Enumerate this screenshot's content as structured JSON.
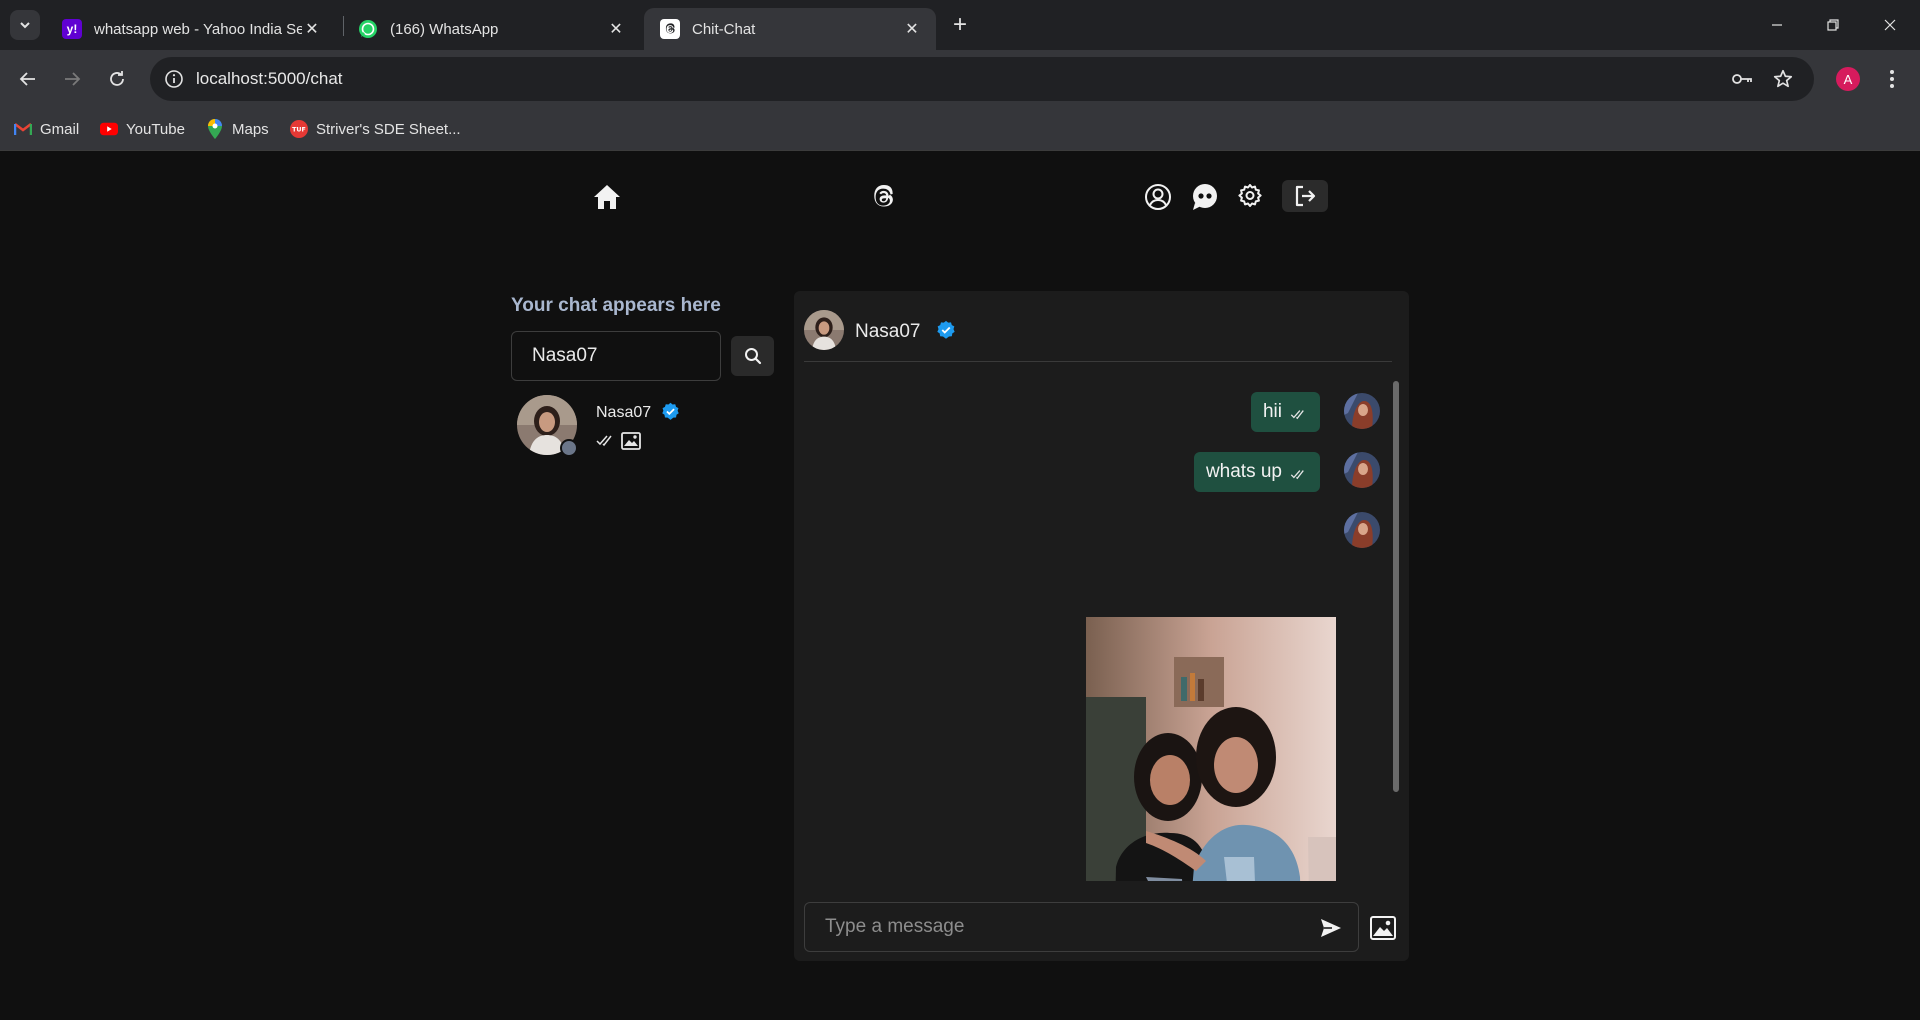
{
  "browser": {
    "tabs": [
      {
        "title": "whatsapp web - Yahoo India Se",
        "favicon": "yahoo-icon",
        "favicon_color": "#6001d2",
        "favicon_text": "y!"
      },
      {
        "title": "(166) WhatsApp",
        "favicon": "whatsapp-icon",
        "favicon_color": "#25d366"
      },
      {
        "title": "Chit-Chat",
        "favicon": "threads-icon",
        "active": true
      }
    ],
    "url": "localhost:5000/chat",
    "profile_initial": "A",
    "profile_color": "#d61b5d",
    "bookmarks": [
      {
        "label": "Gmail",
        "icon": "gmail-icon"
      },
      {
        "label": "YouTube",
        "icon": "youtube-icon"
      },
      {
        "label": "Maps",
        "icon": "maps-icon"
      },
      {
        "label": "Striver's SDE Sheet...",
        "icon": "tuf-icon"
      }
    ]
  },
  "app": {
    "nav_icons": [
      "home-icon",
      "threads-logo-icon",
      "user-profile-icon",
      "chat-bubbles-icon",
      "gear-icon",
      "logout-icon"
    ],
    "sidebar": {
      "title": "Your chat appears here",
      "search": {
        "value": "Nasa07",
        "placeholder": ""
      },
      "conversations": [
        {
          "name": "Nasa07",
          "verified": true,
          "last_message_icon": "image-icon",
          "seen": true
        }
      ]
    },
    "chat": {
      "user": {
        "name": "Nasa07",
        "verified": true
      },
      "messages": [
        {
          "text": "hii",
          "from_me": true,
          "seen": true
        },
        {
          "text": "whats up",
          "from_me": true,
          "seen": true
        },
        {
          "image": true,
          "from_me": true
        }
      ],
      "input": {
        "value": "",
        "placeholder": "Type a message"
      }
    },
    "colors": {
      "accent_verified": "#1d9bf0",
      "bubble": "#1f5040",
      "sidebar_title": "#a9b7cf"
    }
  }
}
